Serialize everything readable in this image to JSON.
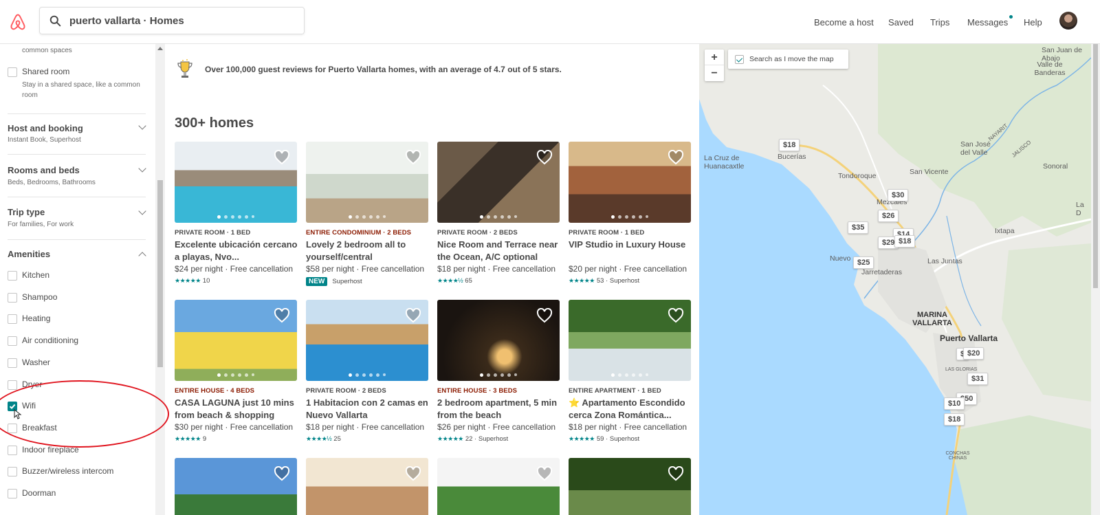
{
  "header": {
    "search_value": "puerto vallarta · Homes",
    "nav": [
      "Become a host",
      "Saved",
      "Trips",
      "Messages",
      "Help"
    ]
  },
  "sidebar": {
    "top_partial": "common spaces",
    "shared_room": {
      "label": "Shared room",
      "desc": "Stay in a shared space, like a common room"
    },
    "sections": [
      {
        "title": "Host and booking",
        "sub": "Instant Book, Superhost"
      },
      {
        "title": "Rooms and beds",
        "sub": "Beds, Bedrooms, Bathrooms"
      },
      {
        "title": "Trip type",
        "sub": "For families, For work"
      }
    ],
    "amenities_title": "Amenities",
    "amenities": [
      {
        "label": "Kitchen",
        "checked": false
      },
      {
        "label": "Shampoo",
        "checked": false
      },
      {
        "label": "Heating",
        "checked": false
      },
      {
        "label": "Air conditioning",
        "checked": false
      },
      {
        "label": "Washer",
        "checked": false
      },
      {
        "label": "Dryer",
        "checked": false
      },
      {
        "label": "Wifi",
        "checked": true
      },
      {
        "label": "Breakfast",
        "checked": false
      },
      {
        "label": "Indoor fireplace",
        "checked": false
      },
      {
        "label": "Buzzer/wireless intercom",
        "checked": false
      },
      {
        "label": "Doorman",
        "checked": false
      }
    ]
  },
  "main": {
    "banner": "Over 100,000 guest reviews for Puerto Vallarta homes, with an average of 4.7 out of 5 stars.",
    "count": "300+ homes",
    "listings": [
      {
        "kind": "PRIVATE ROOM · 1 BED",
        "kind_color": "#484848",
        "title": "Excelente ubicación cercano a playas, Nvo...",
        "price": "$24 per night · Free cancellation",
        "stars": "★★★★★",
        "reviews": "10",
        "superhost": "",
        "new": false
      },
      {
        "kind": "ENTIRE CONDOMINIUM · 2 BEDS",
        "kind_color": "#8b1a00",
        "title": "Lovely 2 bedroom all to yourself/central",
        "price": "$58 per night · Free cancellation",
        "stars": "",
        "reviews": "",
        "superhost": "Superhost",
        "new": true,
        "new_label": "NEW"
      },
      {
        "kind": "PRIVATE ROOM · 2 BEDS",
        "kind_color": "#484848",
        "title": "Nice Room and Terrace near the Ocean, A/C optional",
        "price": "$18 per night · Free cancellation",
        "stars": "★★★★½",
        "reviews": "65",
        "superhost": "",
        "new": false
      },
      {
        "kind": "PRIVATE ROOM · 1 BED",
        "kind_color": "#484848",
        "title": "VIP Studio in Luxury House",
        "price": "$20 per night · Free cancellation",
        "stars": "★★★★★",
        "reviews": "53 · Superhost",
        "superhost": "",
        "new": false
      },
      {
        "kind": "ENTIRE HOUSE · 4 BEDS",
        "kind_color": "#8b1a00",
        "title": "CASA LAGUNA just 10 mins from beach & shopping",
        "price": "$30 per night · Free cancellation",
        "stars": "★★★★★",
        "reviews": "9",
        "superhost": "",
        "new": false
      },
      {
        "kind": "PRIVATE ROOM · 2 BEDS",
        "kind_color": "#484848",
        "title": "1 Habitacion con 2 camas en Nuevo Vallarta",
        "price": "$18 per night · Free cancellation",
        "stars": "★★★★½",
        "reviews": "25",
        "superhost": "",
        "new": false
      },
      {
        "kind": "ENTIRE HOUSE · 3 BEDS",
        "kind_color": "#8b1a00",
        "title": "2 bedroom apartment, 5 min from the beach",
        "price": "$26 per night · Free cancellation",
        "stars": "★★★★★",
        "reviews": "22 · Superhost",
        "superhost": "",
        "new": false
      },
      {
        "kind": "ENTIRE APARTMENT · 1 BED",
        "kind_color": "#484848",
        "title": "⭐ Apartamento Escondido cerca Zona Romántica...",
        "price": "$18 per night · Free cancellation",
        "stars": "★★★★★",
        "reviews": "59 · Superhost",
        "superhost": "",
        "new": false
      }
    ]
  },
  "map": {
    "search_as_move": "Search as I move the map",
    "zoom_in": "+",
    "zoom_out": "−",
    "prices": [
      "$18",
      "$30",
      "$26",
      "$35",
      "$14",
      "$29",
      "$18",
      "$25",
      "$20",
      "$31",
      "$50",
      "$10",
      "$18",
      "$"
    ],
    "places": [
      "San Juan de Abajo",
      "Valle de Banderas",
      "La Cruz de Huanacaxtle",
      "Bucerías",
      "San José del Valle",
      "NAYARIT",
      "JALISCO",
      "San Vicente",
      "Sonoral",
      "Tondoroque",
      "Mezcales",
      "Ixtapa",
      "Las Juntas",
      "Nuevo",
      "Jarretaderas",
      "MARINA VALLARTA",
      "Puerto Vallarta",
      "LAS GLORIAS",
      "CONCHAS CHINAS",
      "La D"
    ]
  }
}
